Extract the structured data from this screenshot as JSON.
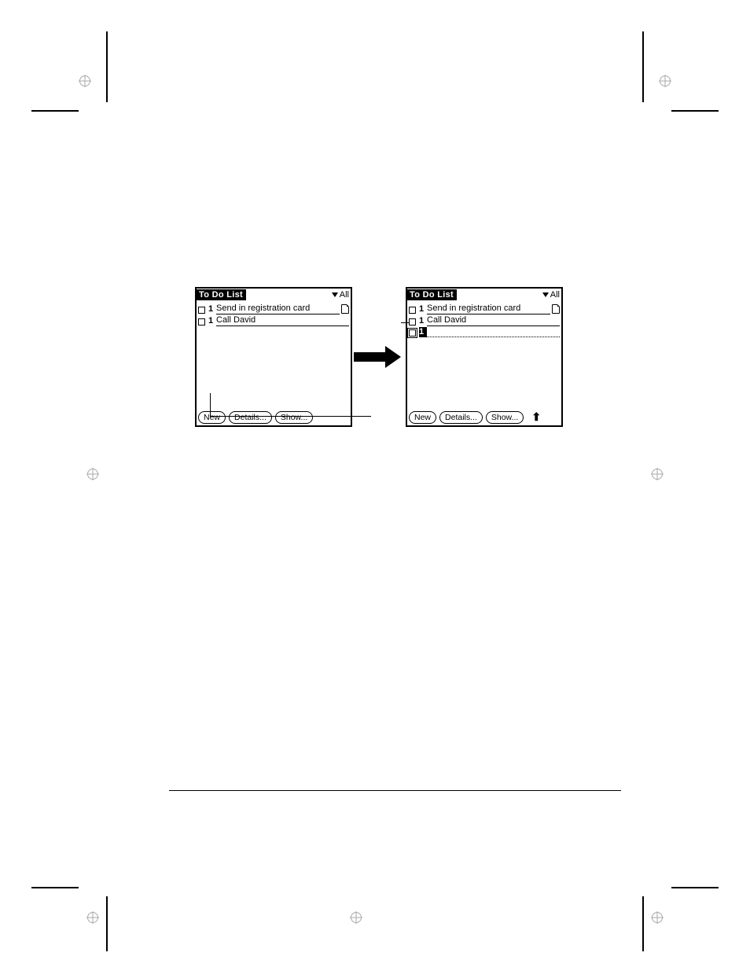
{
  "app": {
    "title": "To Do List",
    "category_dropdown": "All"
  },
  "left_screen": {
    "items": [
      {
        "priority": "1",
        "text": "Send in registration card",
        "has_note": true
      },
      {
        "priority": "1",
        "text": "Call David",
        "has_note": false
      }
    ]
  },
  "right_screen": {
    "items": [
      {
        "priority": "1",
        "text": "Send in registration card",
        "has_note": true
      },
      {
        "priority": "1",
        "text": "Call David",
        "has_note": false
      },
      {
        "priority": "1",
        "text": "",
        "has_note": false,
        "selected": true
      }
    ]
  },
  "buttons": {
    "new": "New",
    "details": "Details...",
    "show": "Show..."
  },
  "shift_glyph": "⬆"
}
